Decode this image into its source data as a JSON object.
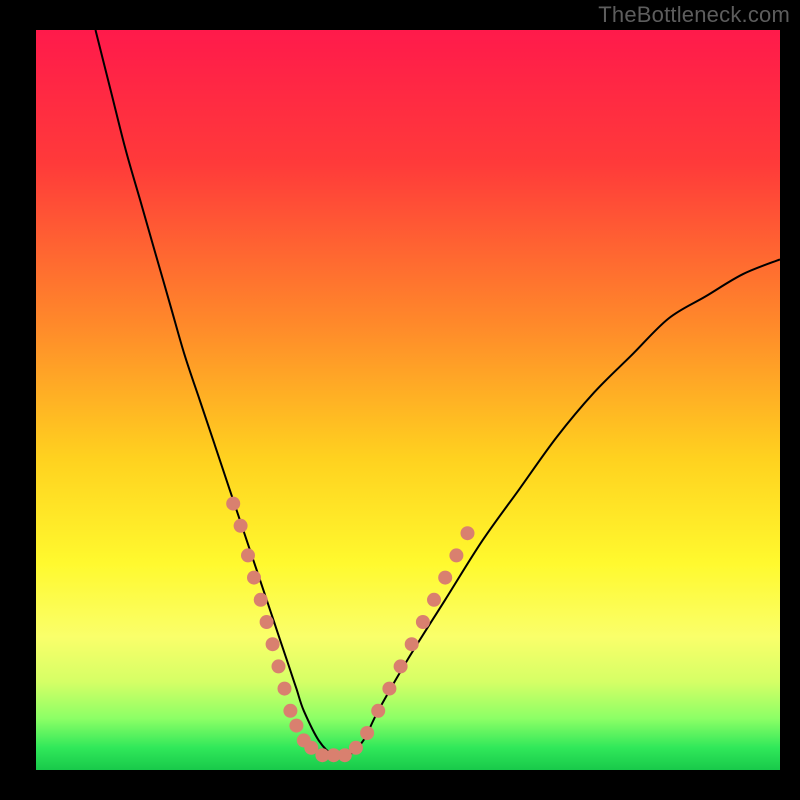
{
  "watermark": "TheBottleneck.com",
  "colors": {
    "background": "#000000",
    "watermark_text": "#5d5d5d",
    "gradient_stops": [
      {
        "offset": 0.0,
        "color": "#ff1a4b"
      },
      {
        "offset": 0.18,
        "color": "#ff3a3a"
      },
      {
        "offset": 0.4,
        "color": "#ff8a2a"
      },
      {
        "offset": 0.58,
        "color": "#ffd21f"
      },
      {
        "offset": 0.72,
        "color": "#fff92e"
      },
      {
        "offset": 0.82,
        "color": "#faff6a"
      },
      {
        "offset": 0.88,
        "color": "#d6ff66"
      },
      {
        "offset": 0.93,
        "color": "#8dff66"
      },
      {
        "offset": 0.97,
        "color": "#30e85a"
      },
      {
        "offset": 1.0,
        "color": "#18c94a"
      }
    ],
    "curve_stroke": "#000000",
    "marker_fill": "#d9806f",
    "marker_stroke": "#b85d4e"
  },
  "chart_data": {
    "type": "line",
    "title": "",
    "xlabel": "",
    "ylabel": "",
    "xlim": [
      0,
      100
    ],
    "ylim": [
      0,
      100
    ],
    "grid": false,
    "legend": false,
    "series": [
      {
        "name": "bottleneck-curve",
        "x": [
          8,
          10,
          12,
          14,
          16,
          18,
          20,
          22,
          24,
          26,
          28,
          30,
          32,
          34,
          35,
          36,
          38,
          40,
          42,
          44,
          46,
          50,
          55,
          60,
          65,
          70,
          75,
          80,
          85,
          90,
          95,
          100
        ],
        "y": [
          100,
          92,
          84,
          77,
          70,
          63,
          56,
          50,
          44,
          38,
          32,
          26,
          20,
          14,
          11,
          8,
          4,
          2,
          2,
          4,
          8,
          15,
          23,
          31,
          38,
          45,
          51,
          56,
          61,
          64,
          67,
          69
        ]
      }
    ],
    "markers": {
      "name": "highlight-points-near-valley",
      "shape": "circle",
      "radius_px": 7,
      "points": [
        {
          "x": 26.5,
          "y": 36
        },
        {
          "x": 27.5,
          "y": 33
        },
        {
          "x": 28.5,
          "y": 29
        },
        {
          "x": 29.3,
          "y": 26
        },
        {
          "x": 30.2,
          "y": 23
        },
        {
          "x": 31.0,
          "y": 20
        },
        {
          "x": 31.8,
          "y": 17
        },
        {
          "x": 32.6,
          "y": 14
        },
        {
          "x": 33.4,
          "y": 11
        },
        {
          "x": 34.2,
          "y": 8
        },
        {
          "x": 35.0,
          "y": 6
        },
        {
          "x": 36.0,
          "y": 4
        },
        {
          "x": 37.0,
          "y": 3
        },
        {
          "x": 38.5,
          "y": 2
        },
        {
          "x": 40.0,
          "y": 2
        },
        {
          "x": 41.5,
          "y": 2
        },
        {
          "x": 43.0,
          "y": 3
        },
        {
          "x": 44.5,
          "y": 5
        },
        {
          "x": 46.0,
          "y": 8
        },
        {
          "x": 47.5,
          "y": 11
        },
        {
          "x": 49.0,
          "y": 14
        },
        {
          "x": 50.5,
          "y": 17
        },
        {
          "x": 52.0,
          "y": 20
        },
        {
          "x": 53.5,
          "y": 23
        },
        {
          "x": 55.0,
          "y": 26
        },
        {
          "x": 56.5,
          "y": 29
        },
        {
          "x": 58.0,
          "y": 32
        }
      ]
    }
  }
}
